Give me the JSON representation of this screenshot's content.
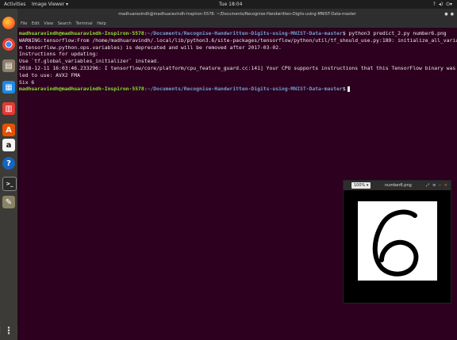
{
  "topbar": {
    "activities": "Activities",
    "app_menu": "Image Viewer ▾",
    "clock": "Tue 18:04",
    "status_icons": [
      "?",
      "◂)",
      "⏻▾"
    ]
  },
  "dock": {
    "items": [
      {
        "name": "firefox-icon",
        "glyph": ""
      },
      {
        "name": "chrome-icon",
        "glyph": ""
      },
      {
        "name": "files-icon",
        "glyph": "▤"
      },
      {
        "name": "libreoffice-writer-icon",
        "glyph": "▦"
      },
      {
        "name": "libreoffice-impress-icon",
        "glyph": "▥"
      },
      {
        "name": "ubuntu-software-icon",
        "glyph": "A"
      },
      {
        "name": "amazon-icon",
        "glyph": "a"
      },
      {
        "name": "help-icon",
        "glyph": "?"
      },
      {
        "name": "terminal-icon",
        "glyph": ">_"
      },
      {
        "name": "gimp-icon",
        "glyph": "✎"
      }
    ],
    "apps_glyph": "⋮⋮⋮"
  },
  "terminal": {
    "title": "madhuaravindh@madhuaravindh-Inspiron-5578: ~/Documents/Recognise-Handwritten-Digits-using-MNIST-Data-master",
    "menu": [
      "File",
      "Edit",
      "View",
      "Search",
      "Terminal",
      "Help"
    ],
    "user_host": "madhuaravindh@madhuaravindh-Inspiron-5578",
    "path": ":~/Documents/Recognise-Handwritten-Digits-using-MNIST-Data-master",
    "command": "$ python3 predict_2.py number6.png",
    "output_lines": [
      "WARNING:tensorflow:From /home/madhuaravindh/.local/lib/python3.6/site-packages/tensorflow/python/util/tf_should_use.py:189: initialize_all_variables (fro",
      "m tensorflow.python.ops.variables) is deprecated and will be removed after 2017-03-02.",
      "Instructions for updating:",
      "Use `tf.global_variables_initializer` instead.",
      "2018-12-11 16:03:46.233296: I tensorflow/core/platform/cpu_feature_guard.cc:141] Your CPU supports instructions that this TensorFlow binary was not compi",
      "led to use: AVX2 FMA",
      "Six 6"
    ],
    "prompt_end": "$"
  },
  "viewer": {
    "zoom": "100% ▾",
    "filename": "number6.png",
    "header_icons": [
      "⤢",
      "≡",
      "–",
      "×"
    ],
    "digit": "6"
  }
}
